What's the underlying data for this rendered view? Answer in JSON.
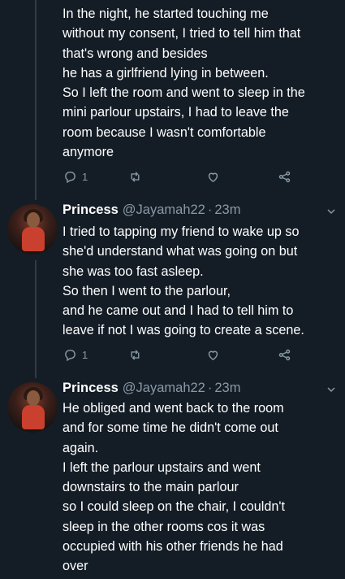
{
  "tweets": [
    {
      "lines": [
        "In the night, he started touching me",
        "without my consent, I tried to tell him that",
        "that's wrong and besides",
        "he has a girlfriend lying in between.",
        "So I left the room and went to sleep in the",
        "mini parlour upstairs, I had to leave the",
        "room because I wasn't comfortable",
        "anymore"
      ],
      "reply_count": "1"
    },
    {
      "display_name": "Princess",
      "handle": "@Jayamah22",
      "separator": "·",
      "time": "23m",
      "lines": [
        "I tried to tapping my friend to wake up so",
        "she'd understand what was going on but",
        "she was too fast asleep.",
        "So then I went to the parlour,",
        "and he came out and I had to tell him to",
        "leave if not I was going to create a scene."
      ],
      "reply_count": "1"
    },
    {
      "display_name": "Princess",
      "handle": "@Jayamah22",
      "separator": "·",
      "time": "23m",
      "lines": [
        "He obliged and went back to the room",
        "and for some time he didn't come out",
        "again.",
        "I left the parlour upstairs and went",
        "downstairs to the main parlour",
        "so I could sleep on the chair, I couldn't",
        "sleep in the other rooms cos it was",
        "occupied with his other friends he had",
        "over"
      ]
    }
  ],
  "icons": {
    "reply": "reply-icon",
    "retweet": "retweet-icon",
    "like": "heart-icon",
    "share": "share-icon",
    "more": "chevron-down-icon"
  },
  "colors": {
    "background": "#141d26",
    "text": "#ffffff",
    "muted": "#8899a6",
    "thread_line": "#2f3b47"
  }
}
